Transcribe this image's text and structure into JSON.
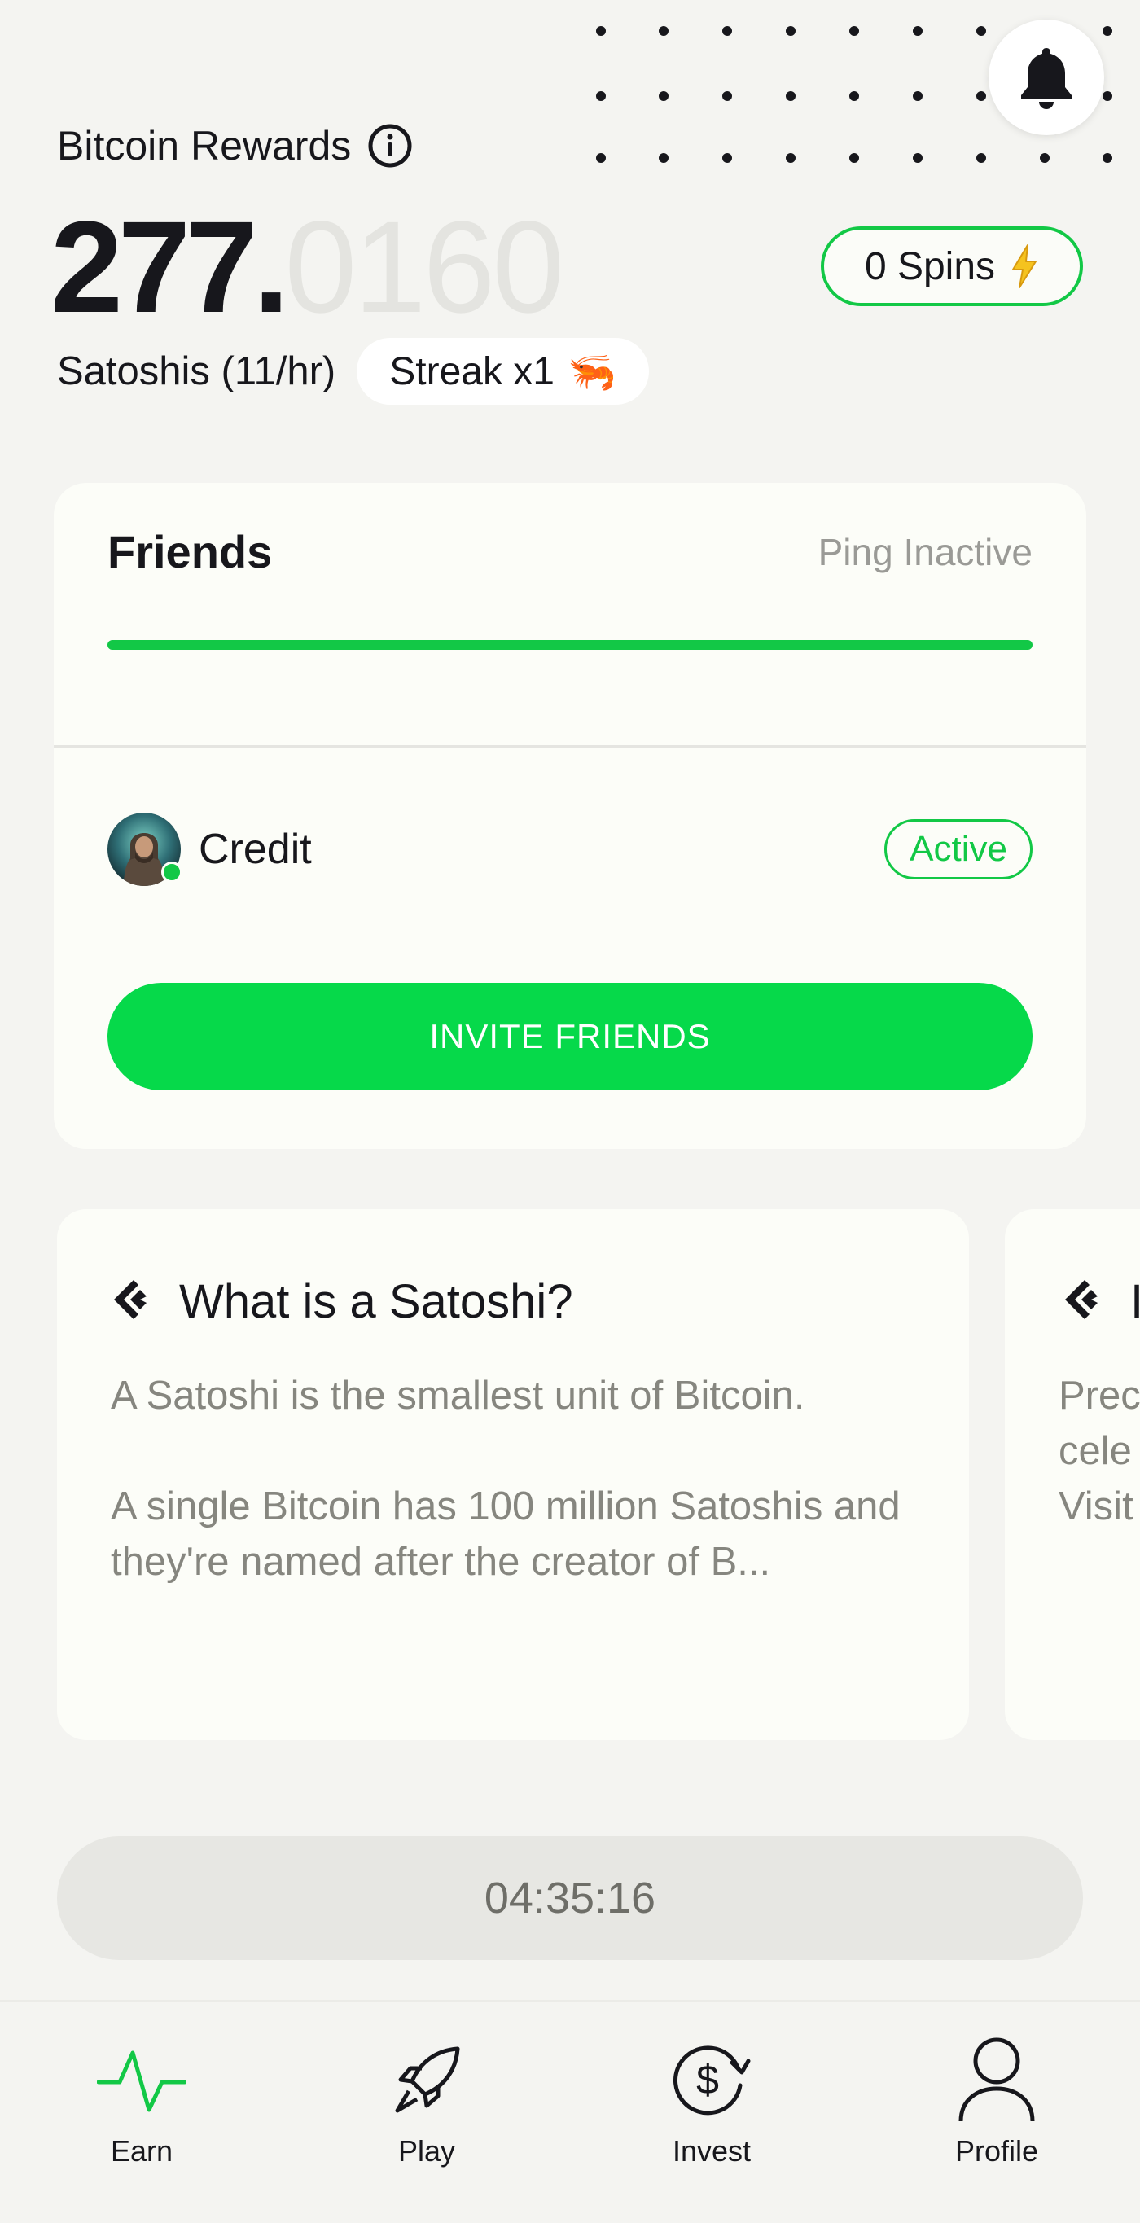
{
  "header": {
    "title": "Bitcoin Rewards",
    "balance_int": "277.",
    "balance_frac": "0160",
    "rate_label": "Satoshis (11/hr)",
    "streak_label": "Streak x1",
    "streak_emoji": "🦐",
    "spins_label": "0 Spins",
    "icons": [
      "info-icon",
      "bell-icon",
      "lightning-icon"
    ]
  },
  "friends_card": {
    "title": "Friends",
    "ping_label": "Ping Inactive",
    "progress_fraction": 1.0,
    "friend": {
      "name": "Credit",
      "status": "Active",
      "online": true
    },
    "invite_label": "INVITE FRIENDS"
  },
  "info_cards": [
    {
      "title": "What is a Satoshi?",
      "paragraphs": [
        "A Satoshi is the smallest unit of Bitcoin.",
        "A single Bitcoin has 100 million Satoshis and they're named after the creator of B..."
      ]
    },
    {
      "title": "I",
      "lines": [
        "Prec",
        "cele",
        "Visit"
      ]
    }
  ],
  "timer": "04:35:16",
  "nav": [
    {
      "label": "Earn",
      "icon": "activity-icon",
      "active": true
    },
    {
      "label": "Play",
      "icon": "rocket-icon",
      "active": false
    },
    {
      "label": "Invest",
      "icon": "dollar-cycle-icon",
      "active": false
    },
    {
      "label": "Profile",
      "icon": "person-icon",
      "active": false
    }
  ],
  "colors": {
    "accent": "#12c846",
    "button": "#06d94a",
    "background": "#f4f4f1",
    "card": "#fcfdf8"
  }
}
